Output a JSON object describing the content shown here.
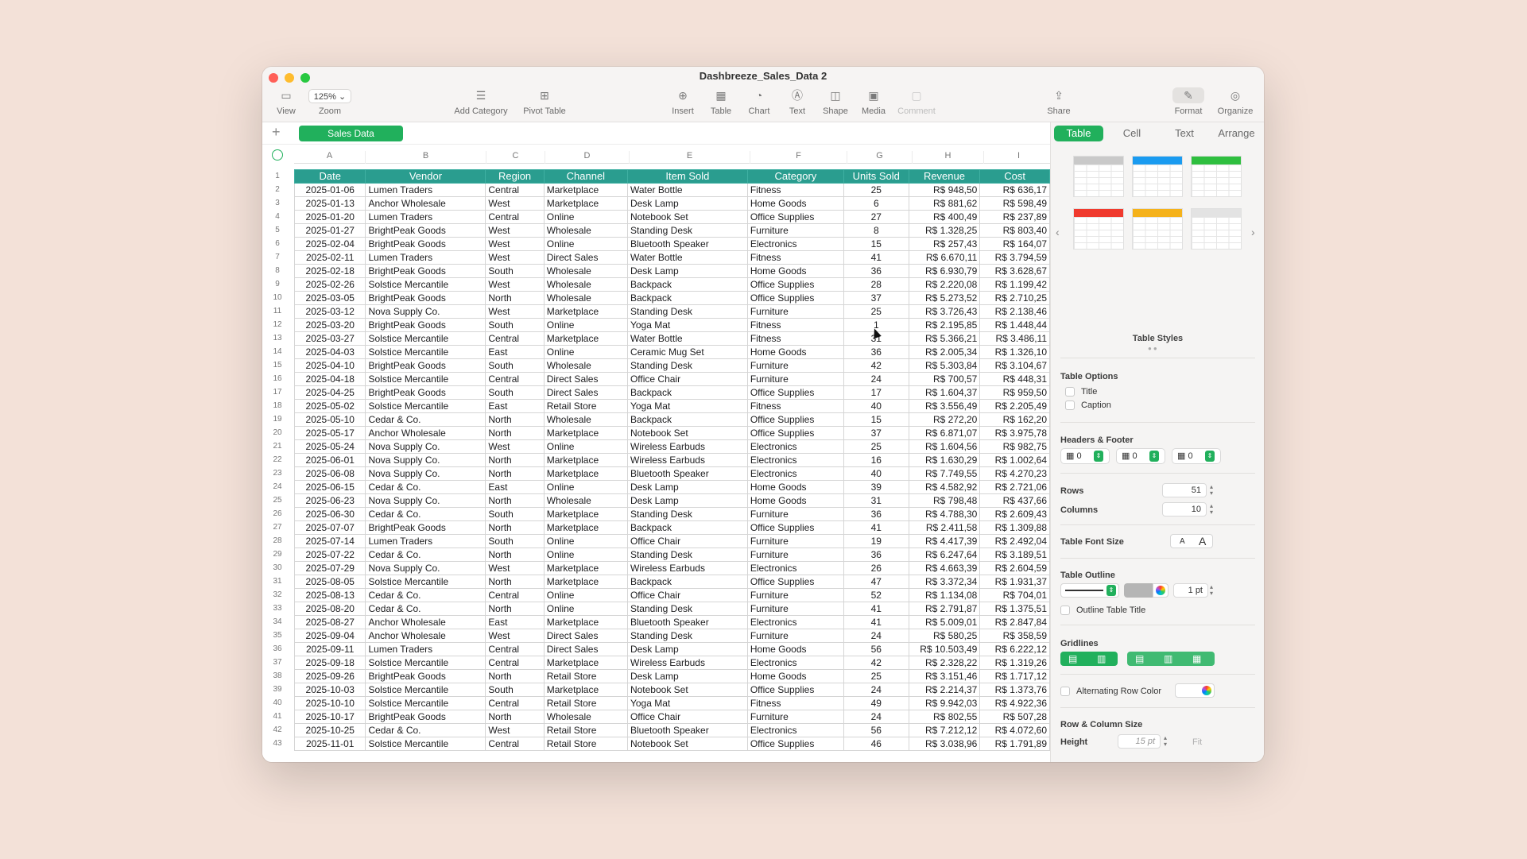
{
  "window": {
    "title": "Dashbreeze_Sales_Data 2"
  },
  "toolbar": {
    "view": "View",
    "zoom_value": "125%",
    "zoom": "Zoom",
    "add_category": "Add Category",
    "pivot_table": "Pivot Table",
    "insert": "Insert",
    "table": "Table",
    "chart": "Chart",
    "text": "Text",
    "shape": "Shape",
    "media": "Media",
    "comment": "Comment",
    "share": "Share",
    "format": "Format",
    "organize": "Organize"
  },
  "sheet": {
    "tab": "Sales Data"
  },
  "columns": [
    "A",
    "B",
    "C",
    "D",
    "E",
    "F",
    "G",
    "H",
    "I"
  ],
  "headers": [
    "Date",
    "Vendor",
    "Region",
    "Channel",
    "Item Sold",
    "Category",
    "Units Sold",
    "Revenue",
    "Cost"
  ],
  "rows": [
    [
      "2025-01-06",
      "Lumen Traders",
      "Central",
      "Marketplace",
      "Water Bottle",
      "Fitness",
      "25",
      "R$ 948,50",
      "R$ 636,17"
    ],
    [
      "2025-01-13",
      "Anchor Wholesale",
      "West",
      "Marketplace",
      "Desk Lamp",
      "Home Goods",
      "6",
      "R$ 881,62",
      "R$ 598,49"
    ],
    [
      "2025-01-20",
      "Lumen Traders",
      "Central",
      "Online",
      "Notebook Set",
      "Office Supplies",
      "27",
      "R$ 400,49",
      "R$ 237,89"
    ],
    [
      "2025-01-27",
      "BrightPeak Goods",
      "West",
      "Wholesale",
      "Standing Desk",
      "Furniture",
      "8",
      "R$ 1.328,25",
      "R$ 803,40"
    ],
    [
      "2025-02-04",
      "BrightPeak Goods",
      "West",
      "Online",
      "Bluetooth Speaker",
      "Electronics",
      "15",
      "R$ 257,43",
      "R$ 164,07"
    ],
    [
      "2025-02-11",
      "Lumen Traders",
      "West",
      "Direct Sales",
      "Water Bottle",
      "Fitness",
      "41",
      "R$ 6.670,11",
      "R$ 3.794,59"
    ],
    [
      "2025-02-18",
      "BrightPeak Goods",
      "South",
      "Wholesale",
      "Desk Lamp",
      "Home Goods",
      "36",
      "R$ 6.930,79",
      "R$ 3.628,67"
    ],
    [
      "2025-02-26",
      "Solstice Mercantile",
      "West",
      "Wholesale",
      "Backpack",
      "Office Supplies",
      "28",
      "R$ 2.220,08",
      "R$ 1.199,42"
    ],
    [
      "2025-03-05",
      "BrightPeak Goods",
      "North",
      "Wholesale",
      "Backpack",
      "Office Supplies",
      "37",
      "R$ 5.273,52",
      "R$ 2.710,25"
    ],
    [
      "2025-03-12",
      "Nova Supply Co.",
      "West",
      "Marketplace",
      "Standing Desk",
      "Furniture",
      "25",
      "R$ 3.726,43",
      "R$ 2.138,46"
    ],
    [
      "2025-03-20",
      "BrightPeak Goods",
      "South",
      "Online",
      "Yoga Mat",
      "Fitness",
      "1",
      "R$ 2.195,85",
      "R$ 1.448,44"
    ],
    [
      "2025-03-27",
      "Solstice Mercantile",
      "Central",
      "Marketplace",
      "Water Bottle",
      "Fitness",
      "31",
      "R$ 5.366,21",
      "R$ 3.486,11"
    ],
    [
      "2025-04-03",
      "Solstice Mercantile",
      "East",
      "Online",
      "Ceramic Mug Set",
      "Home Goods",
      "36",
      "R$ 2.005,34",
      "R$ 1.326,10"
    ],
    [
      "2025-04-10",
      "BrightPeak Goods",
      "South",
      "Wholesale",
      "Standing Desk",
      "Furniture",
      "42",
      "R$ 5.303,84",
      "R$ 3.104,67"
    ],
    [
      "2025-04-18",
      "Solstice Mercantile",
      "Central",
      "Direct Sales",
      "Office Chair",
      "Furniture",
      "24",
      "R$ 700,57",
      "R$ 448,31"
    ],
    [
      "2025-04-25",
      "BrightPeak Goods",
      "South",
      "Direct Sales",
      "Backpack",
      "Office Supplies",
      "17",
      "R$ 1.604,37",
      "R$ 959,50"
    ],
    [
      "2025-05-02",
      "Solstice Mercantile",
      "East",
      "Retail Store",
      "Yoga Mat",
      "Fitness",
      "40",
      "R$ 3.556,49",
      "R$ 2.205,49"
    ],
    [
      "2025-05-10",
      "Cedar & Co.",
      "North",
      "Wholesale",
      "Backpack",
      "Office Supplies",
      "15",
      "R$ 272,20",
      "R$ 162,20"
    ],
    [
      "2025-05-17",
      "Anchor Wholesale",
      "North",
      "Marketplace",
      "Notebook Set",
      "Office Supplies",
      "37",
      "R$ 6.871,07",
      "R$ 3.975,78"
    ],
    [
      "2025-05-24",
      "Nova Supply Co.",
      "West",
      "Online",
      "Wireless Earbuds",
      "Electronics",
      "25",
      "R$ 1.604,56",
      "R$ 982,75"
    ],
    [
      "2025-06-01",
      "Nova Supply Co.",
      "North",
      "Marketplace",
      "Wireless Earbuds",
      "Electronics",
      "16",
      "R$ 1.630,29",
      "R$ 1.002,64"
    ],
    [
      "2025-06-08",
      "Nova Supply Co.",
      "North",
      "Marketplace",
      "Bluetooth Speaker",
      "Electronics",
      "40",
      "R$ 7.749,55",
      "R$ 4.270,23"
    ],
    [
      "2025-06-15",
      "Cedar & Co.",
      "East",
      "Online",
      "Desk Lamp",
      "Home Goods",
      "39",
      "R$ 4.582,92",
      "R$ 2.721,06"
    ],
    [
      "2025-06-23",
      "Nova Supply Co.",
      "North",
      "Wholesale",
      "Desk Lamp",
      "Home Goods",
      "31",
      "R$ 798,48",
      "R$ 437,66"
    ],
    [
      "2025-06-30",
      "Cedar & Co.",
      "South",
      "Marketplace",
      "Standing Desk",
      "Furniture",
      "36",
      "R$ 4.788,30",
      "R$ 2.609,43"
    ],
    [
      "2025-07-07",
      "BrightPeak Goods",
      "North",
      "Marketplace",
      "Backpack",
      "Office Supplies",
      "41",
      "R$ 2.411,58",
      "R$ 1.309,88"
    ],
    [
      "2025-07-14",
      "Lumen Traders",
      "South",
      "Online",
      "Office Chair",
      "Furniture",
      "19",
      "R$ 4.417,39",
      "R$ 2.492,04"
    ],
    [
      "2025-07-22",
      "Cedar & Co.",
      "North",
      "Online",
      "Standing Desk",
      "Furniture",
      "36",
      "R$ 6.247,64",
      "R$ 3.189,51"
    ],
    [
      "2025-07-29",
      "Nova Supply Co.",
      "West",
      "Marketplace",
      "Wireless Earbuds",
      "Electronics",
      "26",
      "R$ 4.663,39",
      "R$ 2.604,59"
    ],
    [
      "2025-08-05",
      "Solstice Mercantile",
      "North",
      "Marketplace",
      "Backpack",
      "Office Supplies",
      "47",
      "R$ 3.372,34",
      "R$ 1.931,37"
    ],
    [
      "2025-08-13",
      "Cedar & Co.",
      "Central",
      "Online",
      "Office Chair",
      "Furniture",
      "52",
      "R$ 1.134,08",
      "R$ 704,01"
    ],
    [
      "2025-08-20",
      "Cedar & Co.",
      "North",
      "Online",
      "Standing Desk",
      "Furniture",
      "41",
      "R$ 2.791,87",
      "R$ 1.375,51"
    ],
    [
      "2025-08-27",
      "Anchor Wholesale",
      "East",
      "Marketplace",
      "Bluetooth Speaker",
      "Electronics",
      "41",
      "R$ 5.009,01",
      "R$ 2.847,84"
    ],
    [
      "2025-09-04",
      "Anchor Wholesale",
      "West",
      "Direct Sales",
      "Standing Desk",
      "Furniture",
      "24",
      "R$ 580,25",
      "R$ 358,59"
    ],
    [
      "2025-09-11",
      "Lumen Traders",
      "Central",
      "Direct Sales",
      "Desk Lamp",
      "Home Goods",
      "56",
      "R$ 10.503,49",
      "R$ 6.222,12"
    ],
    [
      "2025-09-18",
      "Solstice Mercantile",
      "Central",
      "Marketplace",
      "Wireless Earbuds",
      "Electronics",
      "42",
      "R$ 2.328,22",
      "R$ 1.319,26"
    ],
    [
      "2025-09-26",
      "BrightPeak Goods",
      "North",
      "Retail Store",
      "Desk Lamp",
      "Home Goods",
      "25",
      "R$ 3.151,46",
      "R$ 1.717,12"
    ],
    [
      "2025-10-03",
      "Solstice Mercantile",
      "South",
      "Marketplace",
      "Notebook Set",
      "Office Supplies",
      "24",
      "R$ 2.214,37",
      "R$ 1.373,76"
    ],
    [
      "2025-10-10",
      "Solstice Mercantile",
      "Central",
      "Retail Store",
      "Yoga Mat",
      "Fitness",
      "49",
      "R$ 9.942,03",
      "R$ 4.922,36"
    ],
    [
      "2025-10-17",
      "BrightPeak Goods",
      "North",
      "Wholesale",
      "Office Chair",
      "Furniture",
      "24",
      "R$ 802,55",
      "R$ 507,28"
    ],
    [
      "2025-10-25",
      "Cedar & Co.",
      "West",
      "Retail Store",
      "Bluetooth Speaker",
      "Electronics",
      "56",
      "R$ 7.212,12",
      "R$ 4.072,60"
    ],
    [
      "2025-11-01",
      "Solstice Mercantile",
      "Central",
      "Retail Store",
      "Notebook Set",
      "Office Supplies",
      "46",
      "R$ 3.038,96",
      "R$ 1.791,89"
    ]
  ],
  "panel": {
    "tabs": [
      "Table",
      "Cell",
      "Text",
      "Arrange"
    ],
    "active_tab": "Table",
    "table_styles_label": "Table Styles",
    "style_colors": [
      "#c9c9c9",
      "#1a9bf0",
      "#2fbf3f",
      "#f03a2e",
      "#f5b21b",
      "#e3e3e3"
    ],
    "table_options_label": "Table Options",
    "title_option": "Title",
    "caption_option": "Caption",
    "headers_footer_label": "Headers & Footer",
    "header_rows": "0",
    "header_columns": "0",
    "footer_rows": "0",
    "rows_label": "Rows",
    "rows_value": "51",
    "columns_label": "Columns",
    "columns_value": "10",
    "font_size_label": "Table Font Size",
    "font_small": "A",
    "font_large": "A",
    "outline_label": "Table Outline",
    "outline_width": "1 pt",
    "outline_title_label": "Outline Table Title",
    "gridlines_label": "Gridlines",
    "alt_row_label": "Alternating Row Color",
    "row_col_size_label": "Row & Column Size",
    "height_label": "Height",
    "height_value": "15 pt",
    "fit_label": "Fit"
  }
}
